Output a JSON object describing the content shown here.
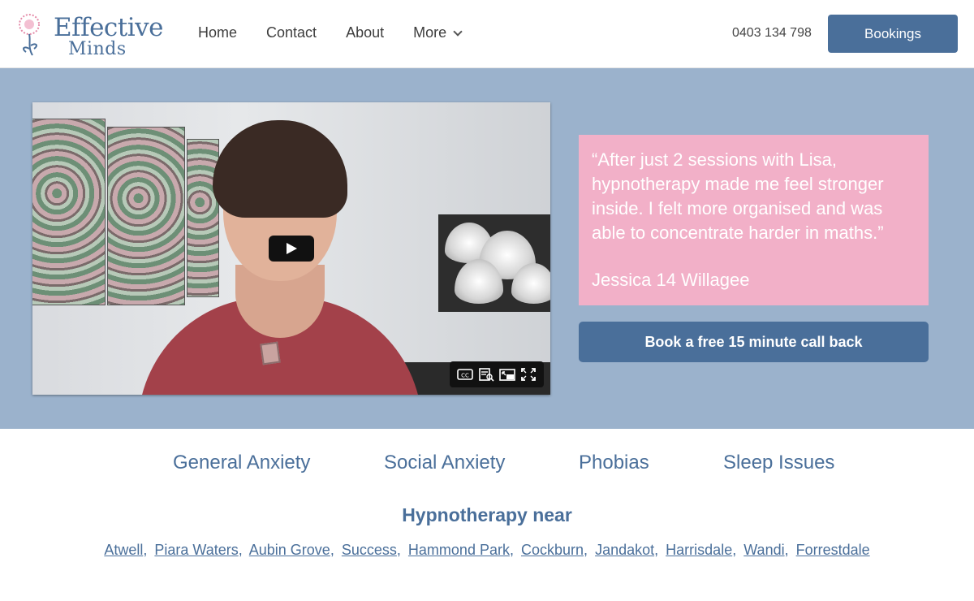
{
  "header": {
    "logo_line1": "Effective",
    "logo_line2": "Minds",
    "nav": [
      {
        "label": "Home"
      },
      {
        "label": "Contact"
      },
      {
        "label": "About"
      },
      {
        "label": "More"
      }
    ],
    "phone": "0403 134 798",
    "bookings_label": "Bookings"
  },
  "hero": {
    "quote": "“After just 2 sessions with Lisa, hypnotherapy made me feel stronger inside. I felt more organised and was able to concentrate harder in maths.”",
    "author": "Jessica 14 Willagee",
    "callback_label": "Book a free 15 minute call back",
    "video_controls": [
      "cc-icon",
      "transcript-icon",
      "pip-icon",
      "fullscreen-icon"
    ]
  },
  "topics": [
    "General Anxiety",
    "Social Anxiety",
    "Phobias",
    "Sleep Issues"
  ],
  "near_title": "Hypnotherapy near",
  "suburbs": [
    "Atwell",
    "Piara Waters",
    "Aubin Grove",
    "Success",
    "Hammond Park",
    "Cockburn",
    "Jandakot",
    "Harrisdale",
    "Wandi",
    "Forrestdale"
  ],
  "colors": {
    "brand_blue": "#4a6f9a",
    "hero_bg": "#9bb2cc",
    "quote_pink": "#f2b0c8"
  }
}
